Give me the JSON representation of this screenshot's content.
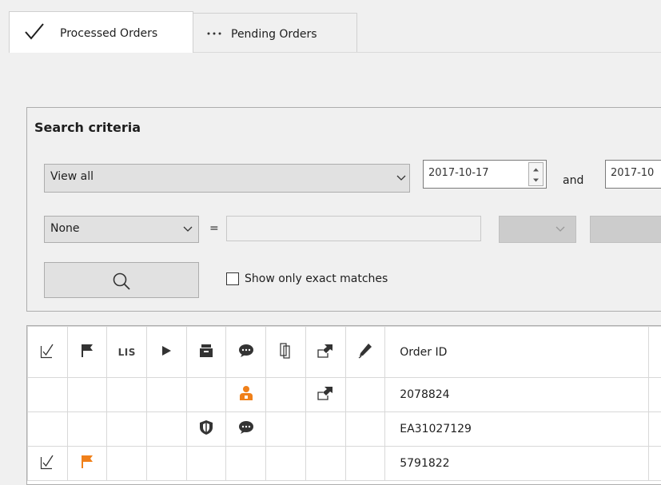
{
  "tabs": [
    {
      "label": "Processed Orders",
      "icon": "checkmark-icon",
      "active": true
    },
    {
      "label": "Pending Orders",
      "icon": "ellipsis-icon",
      "active": false
    }
  ],
  "search": {
    "title": "Search criteria",
    "view_filter": "View all",
    "date_from": "2017-10-17",
    "and_label": "and",
    "date_to": "2017-10",
    "field_filter": "None",
    "equals": "=",
    "value": "",
    "exact_label": "Show only exact matches",
    "exact_checked": false
  },
  "grid": {
    "columns": [
      "check-icon",
      "flag-icon",
      "LIS",
      "play-icon",
      "archive-icon",
      "comment-icon",
      "copy-icon",
      "export-icon",
      "pen-icon",
      "Order ID"
    ],
    "lis_label": "LIS",
    "order_id_header": "Order ID",
    "rows": [
      {
        "order_id": "2078824",
        "icons": [
          "user-orange-icon",
          "export-icon"
        ]
      },
      {
        "order_id": "EA31027129",
        "icons": [
          "shield-icon",
          "comment-icon"
        ]
      },
      {
        "order_id": "5791822",
        "icons": [
          "check-icon",
          "flag-orange-icon"
        ]
      }
    ]
  },
  "colors": {
    "accent_orange": "#f0801a",
    "icon_dark": "#333333"
  }
}
